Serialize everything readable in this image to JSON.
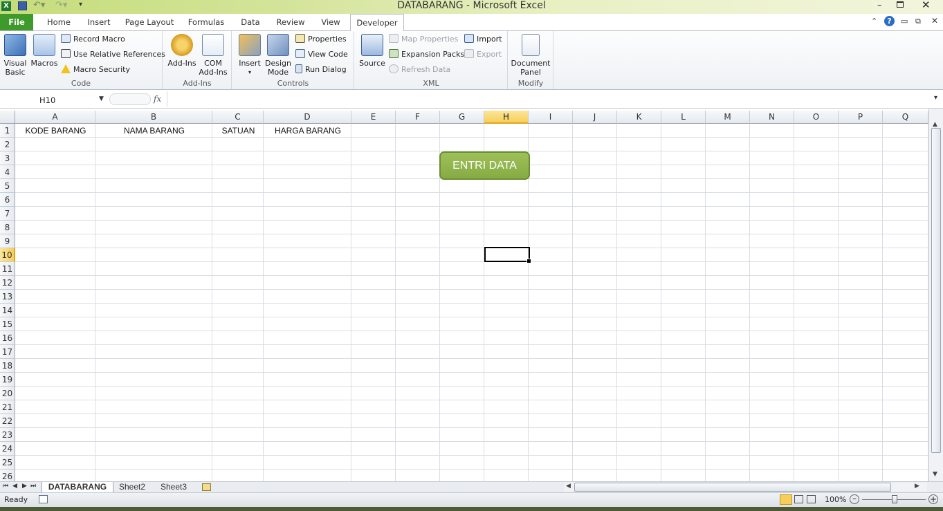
{
  "window": {
    "title": "DATABARANG  -  Microsoft Excel"
  },
  "tabs": [
    {
      "label": "File"
    },
    {
      "label": "Home"
    },
    {
      "label": "Insert"
    },
    {
      "label": "Page Layout"
    },
    {
      "label": "Formulas"
    },
    {
      "label": "Data"
    },
    {
      "label": "Review"
    },
    {
      "label": "View"
    },
    {
      "label": "Developer",
      "active": true
    }
  ],
  "ribbon": {
    "code": {
      "label": "Code",
      "visual_basic": [
        "Visual",
        "Basic"
      ],
      "macros": "Macros",
      "record_macro": "Record Macro",
      "use_relative": "Use Relative References",
      "macro_security": "Macro Security"
    },
    "addins": {
      "label": "Add-Ins",
      "addins": "Add-Ins",
      "com_addins": [
        "COM",
        "Add-Ins"
      ]
    },
    "controls": {
      "label": "Controls",
      "insert": "Insert",
      "design_mode": [
        "Design",
        "Mode"
      ],
      "properties": "Properties",
      "view_code": "View Code",
      "run_dialog": "Run Dialog"
    },
    "xml": {
      "label": "XML",
      "source": "Source",
      "map_properties": "Map Properties",
      "expansion_packs": "Expansion Packs",
      "refresh_data": "Refresh Data",
      "import": "Import",
      "export": "Export"
    },
    "modify": {
      "label": "Modify",
      "document_panel": [
        "Document",
        "Panel"
      ]
    }
  },
  "formula_bar": {
    "name_box": "H10",
    "fx": "fx",
    "value": ""
  },
  "columns": [
    "A",
    "B",
    "C",
    "D",
    "E",
    "F",
    "G",
    "H",
    "I",
    "J",
    "K",
    "L",
    "M",
    "N",
    "O",
    "P",
    "Q"
  ],
  "rows": [
    "1",
    "2",
    "3",
    "4",
    "5",
    "6",
    "7",
    "8",
    "9",
    "10",
    "11",
    "12",
    "13",
    "14",
    "15",
    "16",
    "17",
    "18",
    "19",
    "20",
    "21",
    "22",
    "23",
    "24",
    "25",
    "26"
  ],
  "selected": {
    "column": "H",
    "row": "10"
  },
  "cells": {
    "A1": "KODE BARANG",
    "B1": "NAMA BARANG",
    "C1": "SATUAN",
    "D1": "HARGA BARANG"
  },
  "shape_button": {
    "label": "ENTRI DATA",
    "fill": "#92b54e"
  },
  "sheet_tabs": [
    {
      "label": "DATABARANG",
      "active": true
    },
    {
      "label": "Sheet2"
    },
    {
      "label": "Sheet3"
    }
  ],
  "status": {
    "text": "Ready",
    "zoom": "100%"
  },
  "colors": {
    "file_tab": "#3f9a2c",
    "selected_header": "#f6cf5a"
  }
}
